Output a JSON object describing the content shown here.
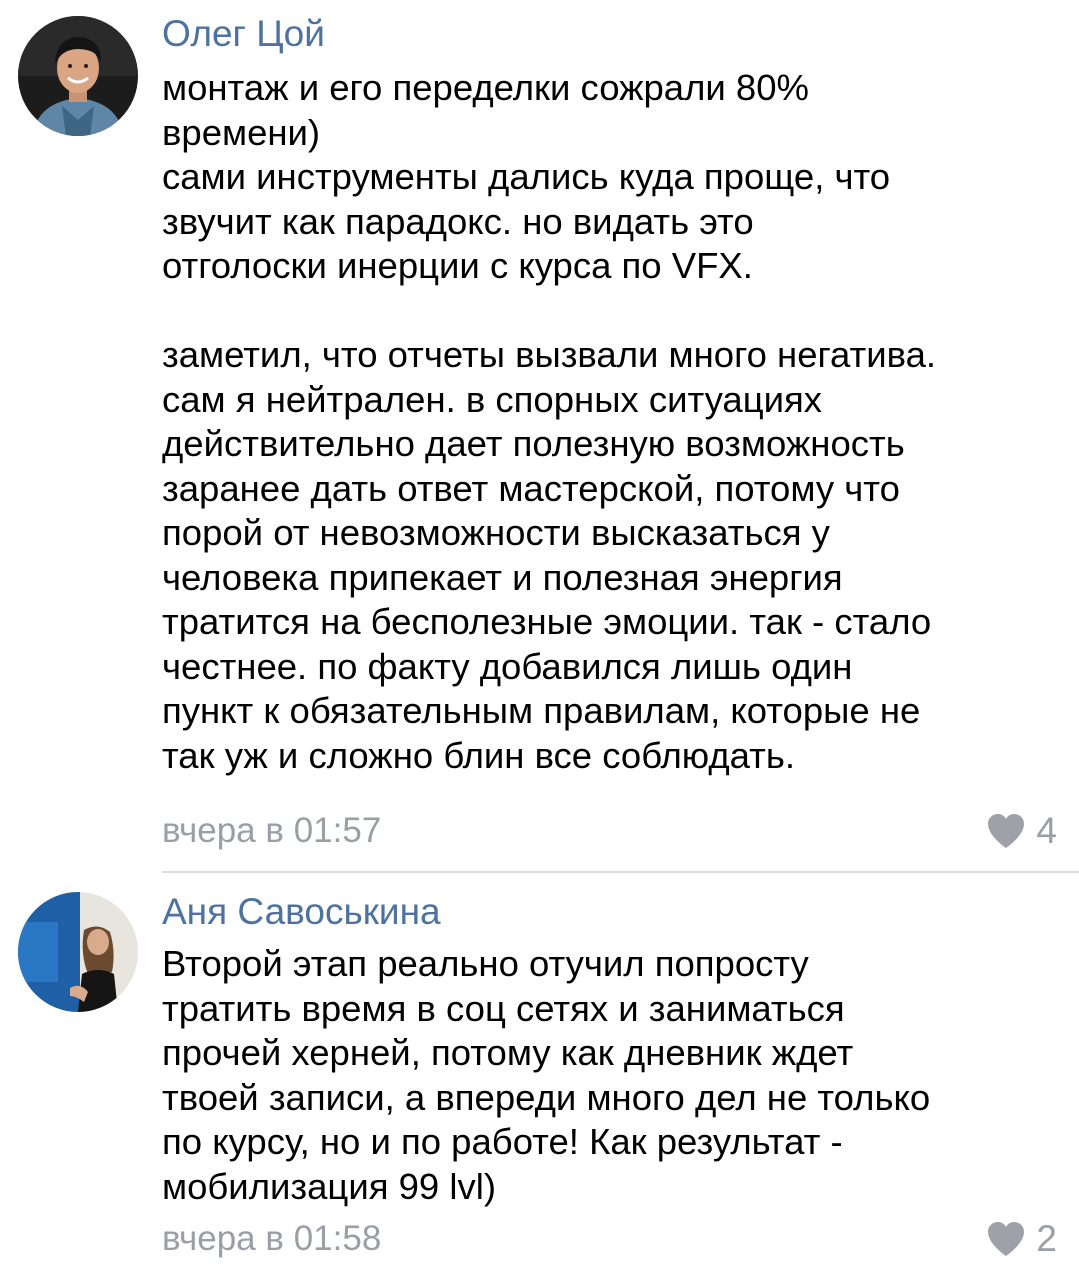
{
  "colors": {
    "author": "#4e729f",
    "meta": "#9a9ea5",
    "heart": "#9ea2a8",
    "divider": "#dcdde0",
    "text": "#000000"
  },
  "comments": [
    {
      "author": "Олег Цой",
      "avatar_icon": "user-avatar-photo",
      "text": "монтаж и его переделки сожрали 80%\nвремени)\nсами инструменты дались куда проще, что\nзвучит как парадокс. но видать это\nотголоски инерции с курса по VFX.\n\nзаметил, что отчеты вызвали много негатива.\nсам я нейтрален. в спорных ситуациях\nдействительно дает полезную возможность\nзаранее дать ответ мастерской, потому что\nпорой от невозможности высказаться у\nчеловека припекает и полезная энергия\nтратится на бесполезные эмоции. так - стало\nчестнее. по факту добавился лишь один\nпункт к обязательным правилам, которые не\nтак уж и сложно блин все соблюдать.",
      "date": "вчера в 01:57",
      "like_icon": "heart-icon",
      "likes": "4"
    },
    {
      "author": "Аня Савоськина",
      "avatar_icon": "user-avatar-photo",
      "text": "Второй этап реально отучил попросту\nтратить время в соц сетях и заниматься\nпрочей херней, потому как дневник ждет\nтвоей записи, а впереди много дел не только\nпо курсу, но и по работе! Как результат -\nмобилизация 99 lvl)",
      "date": "вчера в 01:58",
      "like_icon": "heart-icon",
      "likes": "2"
    }
  ]
}
